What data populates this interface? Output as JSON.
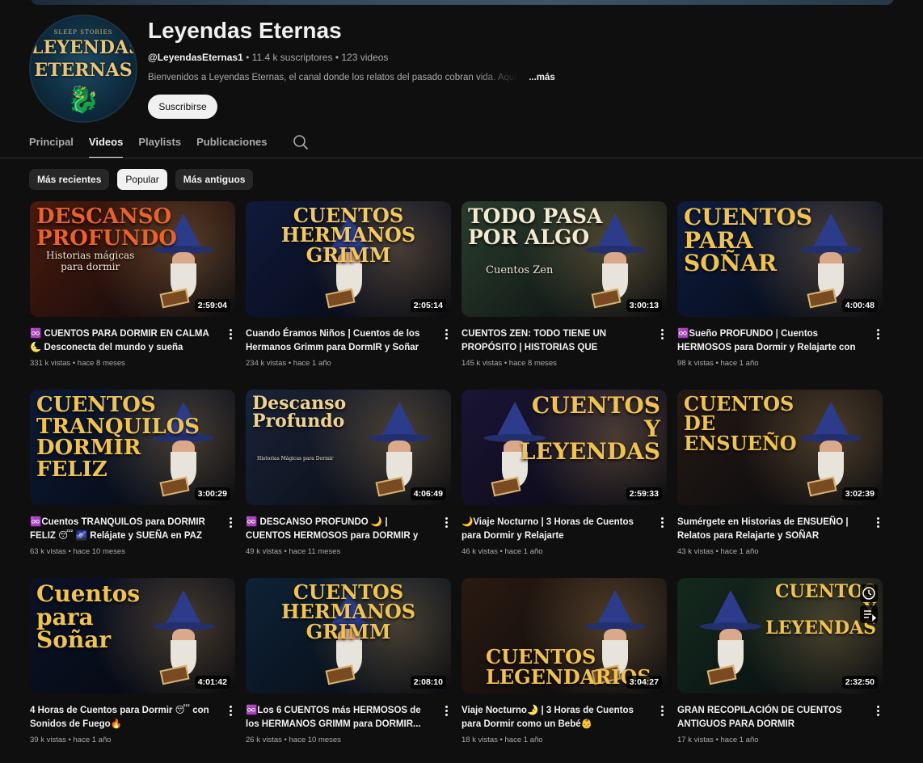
{
  "channel": {
    "name": "Leyendas Eternas",
    "avatar_top": "SLEEP STORIES",
    "avatar_line1": "LEYENDAS",
    "avatar_line2": "ETERNAS",
    "handle": "@LeyendasEternas1",
    "subscribers": "11.4 k suscriptores",
    "videos_count": "123 videos",
    "description": "Bienvenidos a Leyendas Eternas, el canal donde los relatos del pasado cobran vida. Aquí",
    "more": "...más",
    "subscribe_label": "Suscribirse"
  },
  "tabs": [
    "Principal",
    "Videos",
    "Playlists",
    "Publicaciones"
  ],
  "active_tab": "Videos",
  "chips": [
    "Más recientes",
    "Popular",
    "Más antiguos"
  ],
  "active_chip": "Popular",
  "videos": [
    {
      "thumb_title": "DESCANSO\nPROFUNDO",
      "thumb_sub": "Historias mágicas\npara dormir",
      "duration": "2:59:04",
      "title": "♾️ CUENTOS PARA DORMIR EN CALMA 🌜 Desconecta del mundo y sueña profundo",
      "views": "331 k vistas",
      "age": "hace 8 meses",
      "bg": "#4a1a0c",
      "accent": "#e8622a"
    },
    {
      "thumb_title": "CUENTOS\nHERMANOS GRIMM",
      "thumb_sub": "",
      "duration": "2:05:14",
      "title": "Cuando Éramos Niños | Cuentos de los Hermanos Grimm para DormIR y Soñar",
      "views": "234 k vistas",
      "age": "hace 1 año",
      "bg": "#101a3a",
      "accent": "#f2c95c"
    },
    {
      "thumb_title": "TODO PASA\nPOR ALGO",
      "thumb_sub": "Cuentos Zen",
      "duration": "3:00:13",
      "title": "CUENTOS ZEN: TODO TIENE UN PROPÓSITO | HISTORIAS QUE CAMBIARAN TU VIDA",
      "views": "145 k vistas",
      "age": "hace 8 meses",
      "bg": "#2a3d2c",
      "accent": "#f4ead2"
    },
    {
      "thumb_title": "CUENTOS\nPARA\nSOÑAR",
      "thumb_sub": "",
      "duration": "4:00:48",
      "title": "♾️Sueño PROFUNDO | Cuentos HERMOSOS para Dormir y Relajarte con Sonidos...",
      "views": "98 k vistas",
      "age": "hace 1 año",
      "bg": "#0e1c3f",
      "accent": "#f0c24e"
    },
    {
      "thumb_title": "CUENTOS\nTRANQUILOS\nDORMIR\nFELIZ",
      "thumb_sub": "",
      "duration": "3:00:29",
      "title": "♾️Cuentos TRANQUILOS para DORMIR FELIZ 😴 🌌 Relájate y SUEÑA en PAZ",
      "views": "63 k vistas",
      "age": "hace 10 meses",
      "bg": "#0c1a35",
      "accent": "#f0c24e"
    },
    {
      "thumb_title": "Descanso\nProfundo",
      "thumb_sub": "Historias Mágicas para Dormir",
      "duration": "4:06:49",
      "title": "♾️ DESCANSO PROFUNDO 🌙 | CUENTOS HERMOSOS para DORMIR y SONIDOS...",
      "views": "49 k vistas",
      "age": "hace 11 meses",
      "bg": "#1a2438",
      "accent": "#f0d28a"
    },
    {
      "thumb_title": "CUENTOS\nY\nLEYENDAS",
      "thumb_sub": "",
      "duration": "2:59:33",
      "title": "🌙Viaje Nocturno | 3 Horas de Cuentos para Dormir y Relajarte",
      "views": "46 k vistas",
      "age": "hace 1 año",
      "bg": "#1b1436",
      "accent": "#f0c24e"
    },
    {
      "thumb_title": "CUENTOS\nDE\nENSUEÑO",
      "thumb_sub": "",
      "duration": "3:02:39",
      "title": "Sumérgete en Historias de ENSUEÑO | Relatos para Relajarte y SOÑAR",
      "views": "43 k vistas",
      "age": "hace 1 año",
      "bg": "#241a14",
      "accent": "#f0c24e"
    },
    {
      "thumb_title": "Cuentos\npara\nSoñar",
      "thumb_sub": "",
      "duration": "4:01:42",
      "title": "4 Horas de Cuentos para Dormir 😴 con Sonidos de Fuego🔥",
      "views": "39 k vistas",
      "age": "hace 1 año",
      "bg": "#0b1226",
      "accent": "#f0c24e"
    },
    {
      "thumb_title": "CUENTOS\nHERMANOS\nGRIMM",
      "thumb_sub": "",
      "duration": "2:08:10",
      "title": "♾️Los 6 CUENTOS más HERMOSOS de los HERMANOS GRIMM para DORMIR...",
      "views": "26 k vistas",
      "age": "hace 10 meses",
      "bg": "#0e2236",
      "accent": "#f0c24e"
    },
    {
      "thumb_title": "CUENTOS\nLEGENDARIOS",
      "thumb_sub": "",
      "duration": "3:04:27",
      "title": "Viaje Nocturno🌛 | 3 Horas de Cuentos para Dormir como un Bebé👶",
      "views": "18 k vistas",
      "age": "hace 1 año",
      "bg": "#2a1a10",
      "accent": "#f0c24e"
    },
    {
      "thumb_title": "CUENTOS\nY\nLEYENDAS",
      "thumb_sub": "",
      "duration": "2:32:50",
      "title": "GRAN RECOPILACIÓN DE CUENTOS ANTIGUOS PARA DORMIR",
      "views": "17 k vistas",
      "age": "hace 1 año",
      "bg": "#142a1e",
      "accent": "#f0c24e"
    }
  ],
  "colors": {
    "background": "#0f0f0f",
    "text": "#f1f1f1",
    "muted": "#aaaaaa",
    "chip": "#272727"
  }
}
